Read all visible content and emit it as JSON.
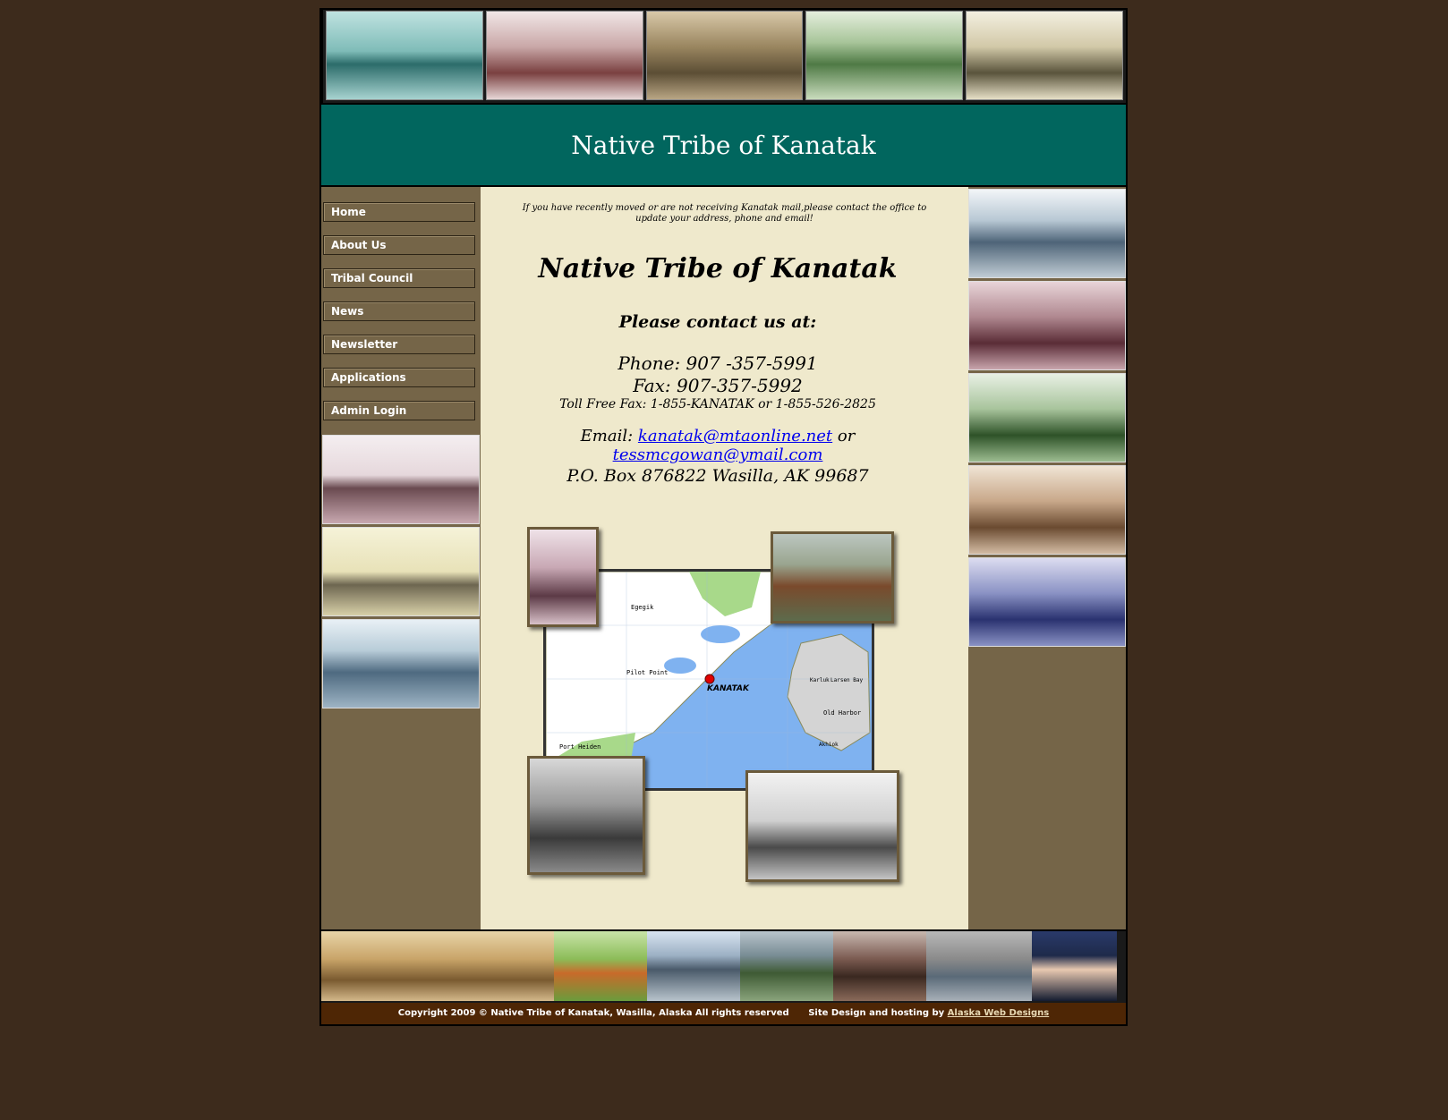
{
  "banner": {
    "title": "Native Tribe of Kanatak"
  },
  "nav": {
    "items": [
      {
        "label": "Home"
      },
      {
        "label": "About Us"
      },
      {
        "label": "Tribal Council"
      },
      {
        "label": "News"
      },
      {
        "label": "Newsletter"
      },
      {
        "label": "Applications"
      },
      {
        "label": "Admin Login"
      }
    ]
  },
  "main": {
    "notice": "If you have recently moved or are not receiving Kanatak mail,please contact the office to update your address, phone and email!",
    "title": "Native Tribe of Kanatak",
    "contact_heading": "Please contact us at:",
    "phone": "Phone: 907 -357-5991",
    "fax": "Fax: 907-357-5992",
    "toll_free": "Toll Free Fax: 1-855-KANATAK or 1-855-526-2825",
    "email_prefix": "Email:",
    "email_1": "kanatak@mtaonline.net",
    "email_sep": "or",
    "email_2": "tessmcgowan@ymail.com",
    "address": "P.O. Box 876822 Wasilla, AK 99687"
  },
  "map": {
    "labels": {
      "kanatak": "KANATAK",
      "pilot_point": "Pilot Point",
      "old_harbor": "Old Harbor",
      "larsen_bay": "Larsen Bay",
      "port_heiden": "Port Heiden",
      "egegik": "Egegik",
      "karluk": "Karluk",
      "akhiok": "Akhiok"
    },
    "colors": {
      "water": "#7fb2f0",
      "land": "#ffffff",
      "forest": "#a8d98a",
      "island": "#d4d4d4",
      "marker": "#e00000"
    }
  },
  "footer": {
    "copyright": "Copyright 2009 © Native Tribe of Kanatak,  Wasilla, Alaska  All rights reserved",
    "credit_prefix": "Site Design and hosting by",
    "credit_link": "Alaska Web Designs"
  },
  "colors": {
    "background": "#3d2b1c",
    "banner": "#01665e",
    "sidebar": "#756548",
    "content": "#efe9cc",
    "footer": "#4e2605",
    "link": "#0000ee"
  }
}
